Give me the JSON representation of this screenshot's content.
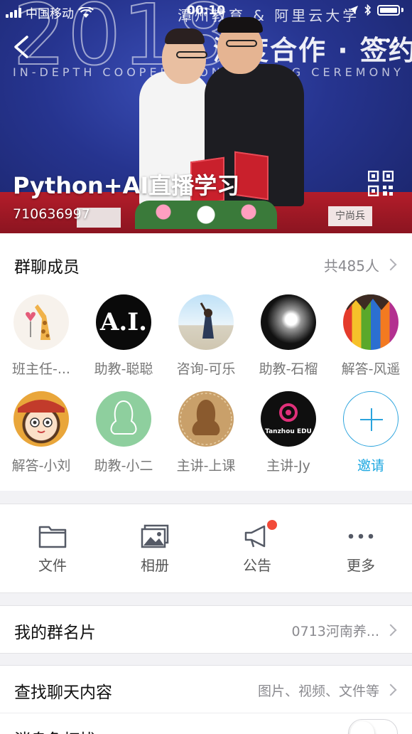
{
  "status_bar": {
    "carrier": "中国移动",
    "time": "00:10",
    "battery_level": 0.95
  },
  "hero": {
    "banner_year": "2018",
    "banner_title": "深度合作 · 签约仪式",
    "banner_subtitle": "IN-DEPTH COOPERATION SIGNING CEREMONY",
    "banner_org": "潭州教育 & 阿里云大学",
    "plaque_right": "宁尚兵",
    "group_name": "Python+AI直播学习",
    "group_id": "710636997"
  },
  "members": {
    "title": "群聊成员",
    "count": "共485人",
    "list": [
      {
        "name": "班主任-...",
        "avatar": "giraffe-avatar"
      },
      {
        "name": "助教-聪聪",
        "avatar": "ai-logo-avatar",
        "avatar_text": "A.I."
      },
      {
        "name": "咨询-可乐",
        "avatar": "beach-girl-avatar"
      },
      {
        "name": "助教-石榴",
        "avatar": "smoke-avatar"
      },
      {
        "name": "解答-风遥",
        "avatar": "pencils-avatar"
      },
      {
        "name": "解答-小刘",
        "avatar": "anime-girl-avatar"
      },
      {
        "name": "助教-小二",
        "avatar": "qq-penguin-green-avatar"
      },
      {
        "name": "主讲-上课",
        "avatar": "qq-penguin-leather-avatar"
      },
      {
        "name": "主讲-Jy",
        "avatar": "tanzhou-edu-avatar",
        "avatar_text": "Tanzhou EDU"
      }
    ],
    "invite_label": "邀请"
  },
  "tools": [
    {
      "label": "文件",
      "icon": "folder-icon"
    },
    {
      "label": "相册",
      "icon": "photo-album-icon"
    },
    {
      "label": "公告",
      "icon": "megaphone-icon",
      "has_dot": true
    },
    {
      "label": "更多",
      "icon": "more-dots-icon"
    }
  ],
  "rows": {
    "card_label": "我的群名片",
    "card_value": "0713河南养...",
    "search_label": "查找聊天内容",
    "search_value": "图片、视频、文件等",
    "notify_label": "消息免打扰"
  },
  "colors": {
    "accent": "#1aa6e0",
    "badge_red": "#f24a39",
    "banner_blue": "#26348f"
  }
}
